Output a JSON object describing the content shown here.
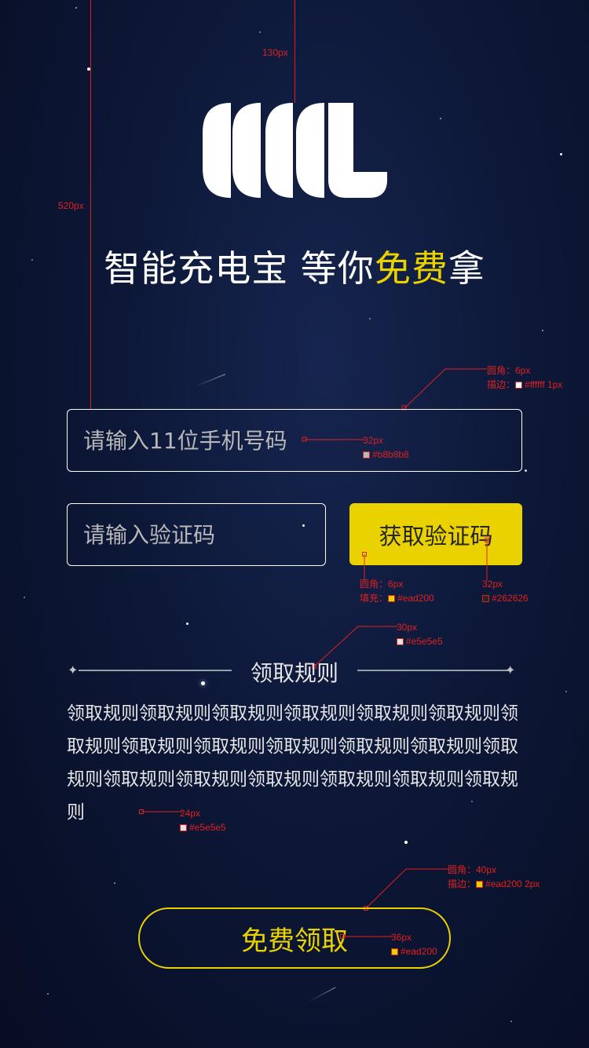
{
  "headline": {
    "prefix": "智能充电宝 等你",
    "highlight": "免费",
    "suffix": "拿"
  },
  "form": {
    "phone_placeholder": "请输入11位手机号码",
    "code_placeholder": "请输入验证码",
    "get_code_label": "获取验证码"
  },
  "rules": {
    "title": "领取规则",
    "body": "领取规则领取规则领取规则领取规则领取规则领取规则领取规则领取规则领取规则领取规则领取规则领取规则领取规则领取规则领取规则领取规则领取规则领取规则领取规则"
  },
  "claim_label": "免费领取",
  "annotations": {
    "top_gap": "130px",
    "top_to_input": "520px",
    "input_border_radius": "圆角：6px",
    "input_border_stroke": "描边：",
    "input_border_color": "#ffffff 1px",
    "input_font_size": "32px",
    "input_font_color": "#b8b8b8",
    "btn_radius": "圆角：6px",
    "btn_fill_label": "填充：",
    "btn_fill": "#ead200",
    "btn_font_size": "32px",
    "btn_font_color": "#262626",
    "rules_title_size": "30px",
    "rules_title_color": "#e5e5e5",
    "rules_body_size": "24px",
    "rules_body_color": "#e5e5e5",
    "claim_radius": "圆角：40px",
    "claim_stroke_label": "描边：",
    "claim_stroke": "#ead200 2px",
    "claim_font_size": "36px",
    "claim_font_color": "#ead200"
  },
  "colors": {
    "accent": "#ead200",
    "text": "#e5e5e5",
    "placeholder": "#b8b8b8",
    "dark_text": "#262626",
    "border": "#ffffff"
  }
}
